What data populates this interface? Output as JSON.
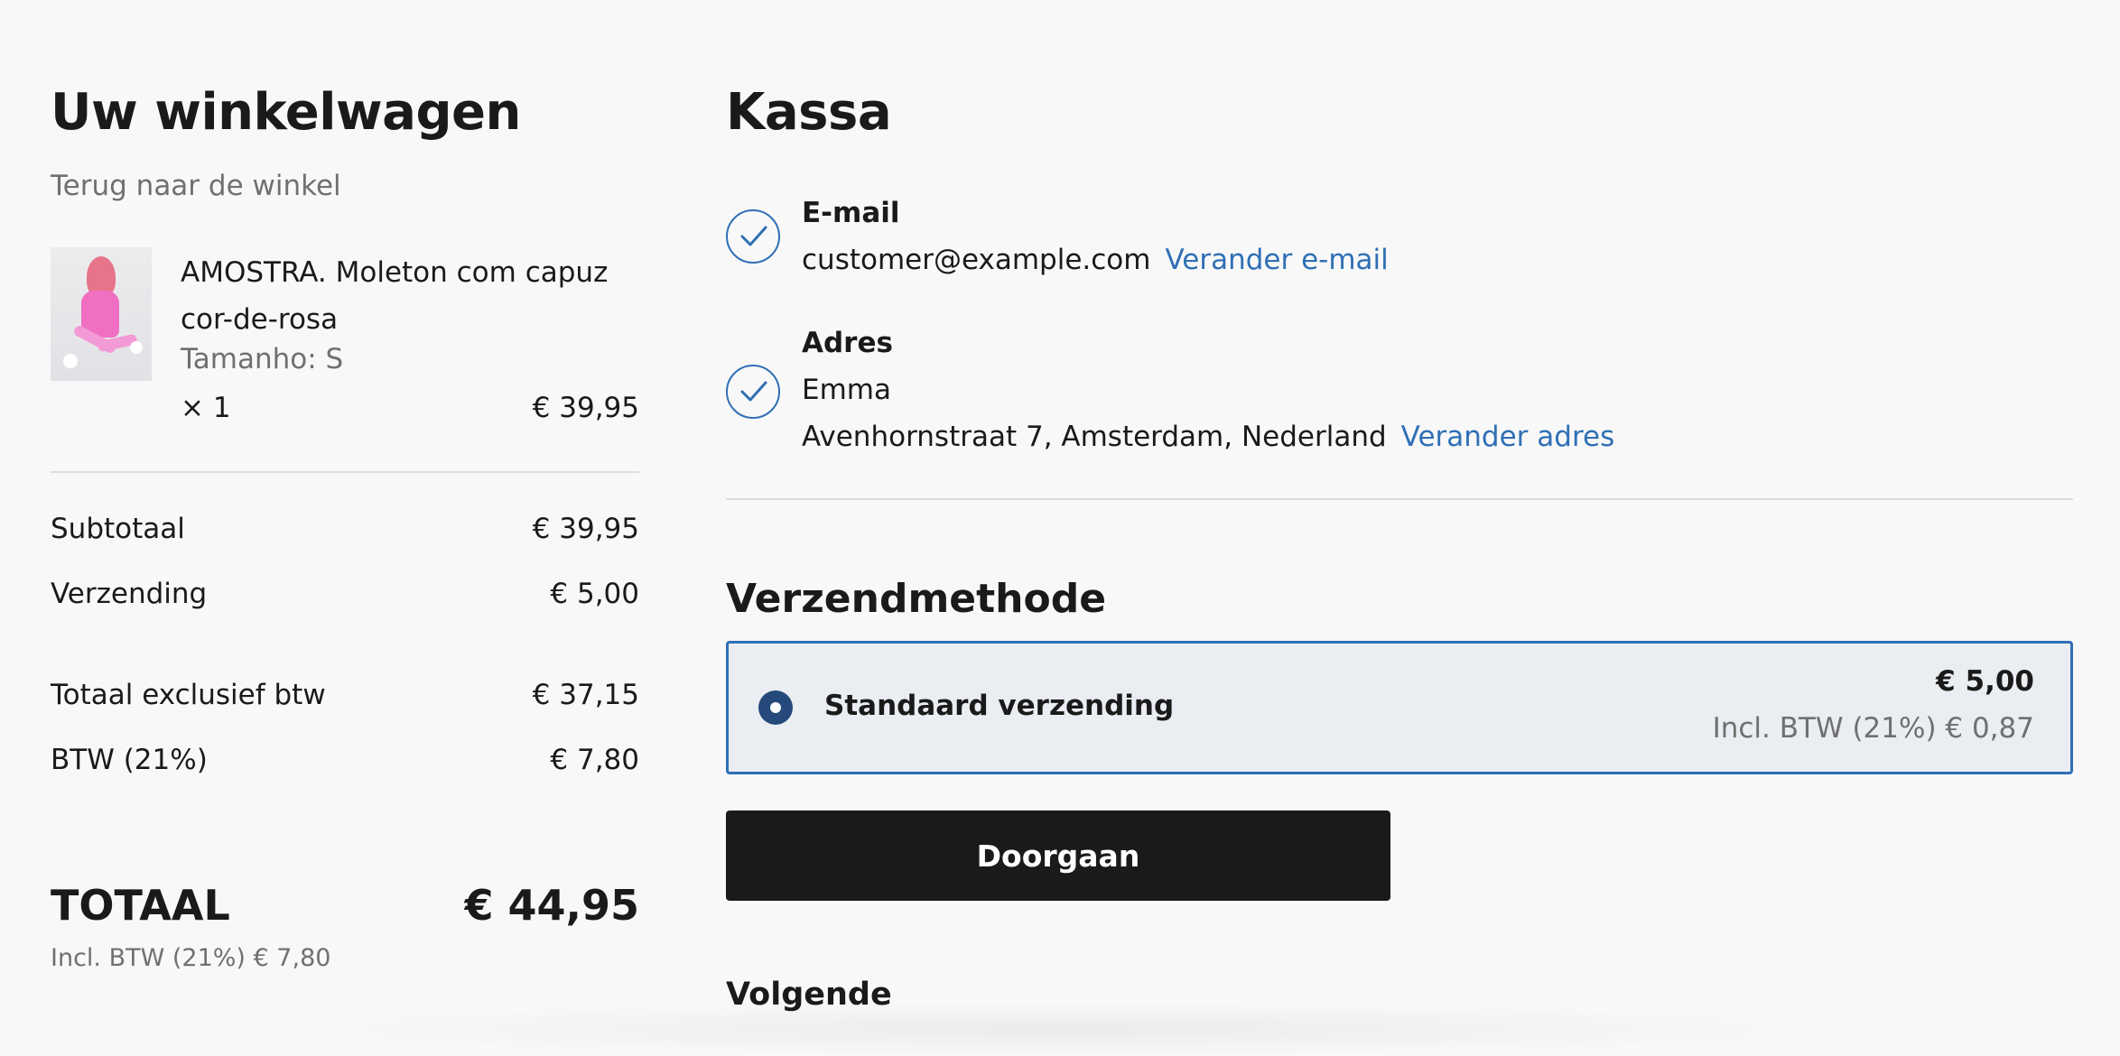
{
  "cart": {
    "title": "Uw winkelwagen",
    "back_link": "Terug naar de winkel",
    "item": {
      "name": "AMOSTRA. Moleton com capuz cor-de-rosa",
      "variant": "Tamanho: S",
      "quantity": "× 1",
      "price": "€ 39,95",
      "image_icon": "product-thumbnail"
    },
    "subtotal_label": "Subtotaal",
    "subtotal_value": "€ 39,95",
    "shipping_label": "Verzending",
    "shipping_value": "€ 5,00",
    "excl_label": "Totaal exclusief btw",
    "excl_value": "€ 37,15",
    "vat_label": "BTW (21%)",
    "vat_value": "€ 7,80",
    "total_label": "TOTAAL",
    "total_value": "€ 44,95",
    "total_tax": "Incl. BTW (21%) € 7,80"
  },
  "checkout": {
    "title": "Kassa",
    "email": {
      "title": "E-mail",
      "value": "customer@example.com",
      "change_link": "Verander e-mail"
    },
    "address": {
      "title": "Adres",
      "name": "Emma",
      "line": "Avenhornstraat 7, Amsterdam, Nederland",
      "change_link": "Verander adres"
    },
    "shipping_method": {
      "title": "Verzendmethode",
      "option_name": "Standaard verzending",
      "option_price": "€ 5,00",
      "option_tax": "Incl. BTW (21%) € 0,87"
    },
    "continue_button": "Doorgaan",
    "next_label": "Volgende"
  },
  "colors": {
    "accent": "#2f6fb5",
    "radio": "#24497a",
    "button": "#1a1a1a",
    "background": "#f8f8f8"
  }
}
